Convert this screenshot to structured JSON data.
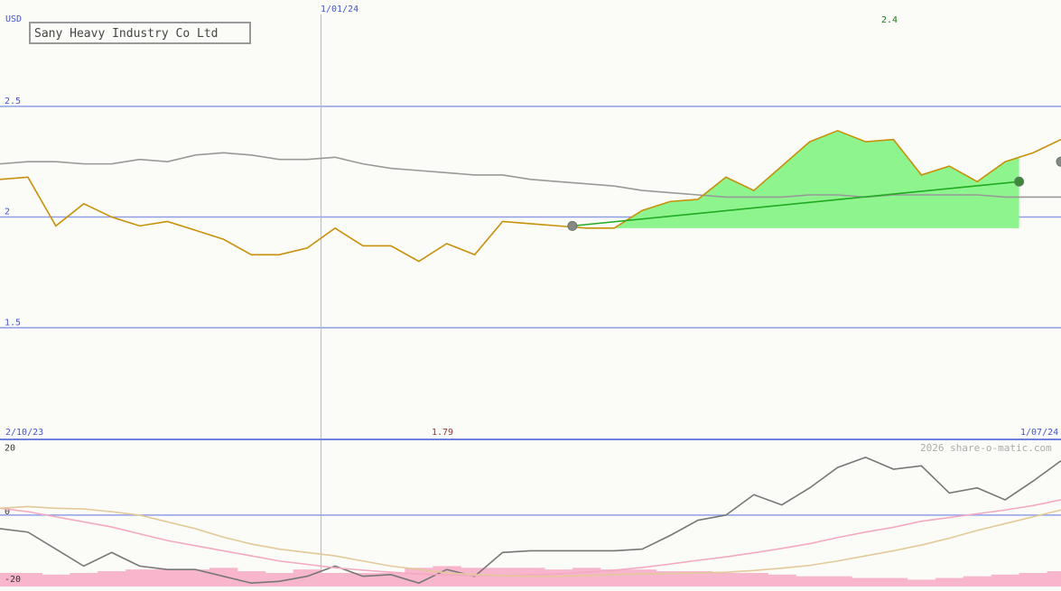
{
  "chart_data": [
    {
      "type": "line",
      "title": "Sany Heavy Industry Co Ltd",
      "ylabel": "USD",
      "ylim": [
        1.0,
        2.98
      ],
      "yticks": [
        {
          "value": 2.5,
          "label": "2.5"
        },
        {
          "value": 2.0,
          "label": "2"
        },
        {
          "value": 1.5,
          "label": "1.5"
        }
      ],
      "date_labels": {
        "start": "2/10/23",
        "mid": "1/01/24",
        "end": "1/07/24"
      },
      "mid_index": 11.5,
      "annotations": {
        "high_label": "2.4",
        "low_label": "1.79"
      },
      "watermark": "2026 share-o-matic.com",
      "grid": true,
      "colors": {
        "price": "#c8900a",
        "average": "#999999",
        "trend": "#22aa22",
        "gain_fill": "#8ef58e",
        "grid": "#8f9ee6",
        "marker_start": "#888888",
        "marker_end": "#3a8a3a"
      },
      "x": [
        0,
        1,
        2,
        3,
        4,
        5,
        6,
        7,
        8,
        9,
        10,
        11,
        12,
        13,
        14,
        15,
        16,
        17,
        18,
        19,
        20,
        21,
        22,
        23,
        24,
        25,
        26,
        27,
        28,
        29,
        30,
        31,
        32,
        33,
        34,
        35,
        36,
        37,
        38
      ],
      "series": [
        {
          "name": "",
          "role": "price",
          "values": [
            2.17,
            2.18,
            1.96,
            2.06,
            2.0,
            1.96,
            1.98,
            1.94,
            1.9,
            1.83,
            1.83,
            1.86,
            1.95,
            1.87,
            1.87,
            1.8,
            1.88,
            1.83,
            1.98,
            1.97,
            1.96,
            1.95,
            1.95,
            2.03,
            2.07,
            2.08,
            2.18,
            2.12,
            2.23,
            2.34,
            2.39,
            2.34,
            2.35,
            2.19,
            2.23,
            2.16,
            2.25,
            2.29,
            2.35
          ]
        },
        {
          "name": "",
          "role": "average",
          "values": [
            2.24,
            2.25,
            2.25,
            2.24,
            2.24,
            2.26,
            2.25,
            2.28,
            2.29,
            2.28,
            2.26,
            2.26,
            2.27,
            2.24,
            2.22,
            2.21,
            2.2,
            2.19,
            2.19,
            2.17,
            2.16,
            2.15,
            2.14,
            2.12,
            2.11,
            2.1,
            2.09,
            2.09,
            2.09,
            2.1,
            2.1,
            2.09,
            2.1,
            2.1,
            2.1,
            2.1,
            2.09,
            2.09,
            2.09
          ]
        }
      ],
      "trend": {
        "start_index": 20.5,
        "start_value": 1.96,
        "end_index": 36.5,
        "end_value": 2.16,
        "base_value": 1.95
      },
      "markers": [
        {
          "index": 20.5,
          "value": 1.96,
          "role": "start"
        },
        {
          "index": 36.5,
          "value": 2.16,
          "role": "end"
        },
        {
          "index": 38,
          "value": 2.25,
          "role": "start"
        }
      ]
    },
    {
      "type": "line",
      "title": "",
      "ylim": [
        -21,
        22
      ],
      "yticks": [
        {
          "value": 20,
          "label": "20"
        },
        {
          "value": 0,
          "label": "0"
        },
        {
          "value": -20,
          "label": "-20"
        }
      ],
      "grid": true,
      "colors": {
        "momentum": "#777777",
        "fast_avg": "#f4a9c2",
        "slow_avg": "#e3c99a",
        "volume": "#f7b6cc"
      },
      "x": [
        0,
        1,
        2,
        3,
        4,
        5,
        6,
        7,
        8,
        9,
        10,
        11,
        12,
        13,
        14,
        15,
        16,
        17,
        18,
        19,
        20,
        21,
        22,
        23,
        24,
        25,
        26,
        27,
        28,
        29,
        30,
        31,
        32,
        33,
        34,
        35,
        36,
        37,
        38
      ],
      "series": [
        {
          "name": "",
          "role": "momentum",
          "values": [
            -4,
            -5,
            -10,
            -15,
            -11,
            -15,
            -16,
            -16,
            -18,
            -20,
            -19.5,
            -18,
            -15,
            -18,
            -17.5,
            -20,
            -16,
            -18,
            -11,
            -10.5,
            -10.5,
            -10.5,
            -10.5,
            -10,
            -6,
            -1.5,
            0,
            6,
            3,
            8,
            14,
            17,
            13.5,
            14.5,
            6.5,
            8,
            4.5,
            10,
            16
          ]
        },
        {
          "name": "",
          "role": "fast_avg",
          "values": [
            2,
            1,
            -0.5,
            -2,
            -3.5,
            -5.5,
            -7.5,
            -9,
            -10.5,
            -12,
            -13.5,
            -14.5,
            -15.5,
            -16.2,
            -16.8,
            -17.3,
            -17.6,
            -17.8,
            -17.8,
            -17.6,
            -17.3,
            -16.8,
            -16.2,
            -15.4,
            -14.4,
            -13.3,
            -12.3,
            -11.1,
            -9.8,
            -8.4,
            -6.6,
            -5,
            -3.6,
            -1.8,
            -0.7,
            0.4,
            1.5,
            2.8,
            4.5
          ]
        },
        {
          "name": "",
          "role": "slow_avg",
          "values": [
            2,
            2.5,
            2,
            1.8,
            1,
            0,
            -2,
            -4,
            -6.5,
            -8.5,
            -10,
            -11,
            -12,
            -13.5,
            -15,
            -16,
            -17,
            -17.5,
            -17.8,
            -18,
            -18,
            -17.8,
            -17.5,
            -17.3,
            -17.2,
            -17,
            -16.8,
            -16.3,
            -15.6,
            -14.8,
            -13.5,
            -12,
            -10.5,
            -8.8,
            -6.8,
            -4.5,
            -2.5,
            -0.5,
            1.5
          ]
        }
      ],
      "volume": [
        4,
        4,
        3.5,
        4,
        4.5,
        5,
        5,
        5,
        5.5,
        4.5,
        4,
        5,
        4,
        4,
        4,
        5.5,
        6,
        5.5,
        5.5,
        5.5,
        5,
        5.5,
        5,
        5,
        4.5,
        4.5,
        4,
        4,
        3.5,
        3,
        3,
        2.5,
        2.5,
        2,
        2.5,
        3,
        3.5,
        4,
        4.5
      ]
    }
  ]
}
